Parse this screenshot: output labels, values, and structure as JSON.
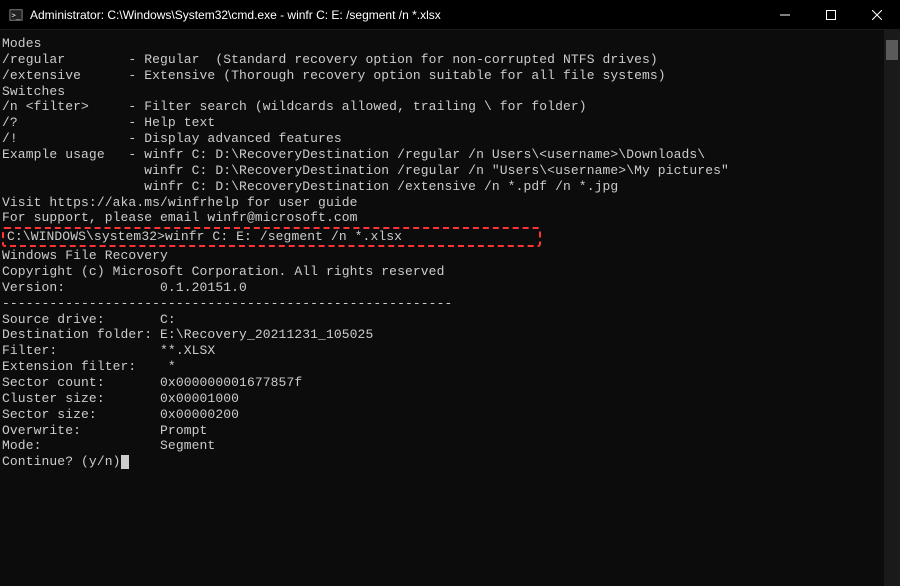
{
  "titlebar": {
    "title": "Administrator: C:\\Windows\\System32\\cmd.exe - winfr  C: E: /segment /n *.xlsx"
  },
  "terminal": {
    "lines": [
      "Modes",
      "/regular        - Regular  (Standard recovery option for non-corrupted NTFS drives)",
      "/extensive      - Extensive (Thorough recovery option suitable for all file systems)",
      "",
      "Switches",
      "/n <filter>     - Filter search (wildcards allowed, trailing \\ for folder)",
      "/?              - Help text",
      "/!              - Display advanced features",
      "",
      "Example usage   - winfr C: D:\\RecoveryDestination /regular /n Users\\<username>\\Downloads\\",
      "                  winfr C: D:\\RecoveryDestination /regular /n \"Users\\<username>\\My pictures\"",
      "                  winfr C: D:\\RecoveryDestination /extensive /n *.pdf /n *.jpg",
      "",
      "",
      "Visit https://aka.ms/winfrhelp for user guide",
      "For support, please email winfr@microsoft.com",
      ""
    ],
    "highlighted_command": "C:\\WINDOWS\\system32>winfr C: E: /segment /n *.xlsx",
    "lines_after": [
      "",
      "Windows File Recovery",
      "Copyright (c) Microsoft Corporation. All rights reserved",
      "Version:            0.1.20151.0",
      "---------------------------------------------------------",
      "",
      "Source drive:       C:",
      "Destination folder: E:\\Recovery_20211231_105025",
      "Filter:             **.XLSX",
      "Extension filter:    *",
      "",
      "Sector count:       0x000000001677857f",
      "Cluster size:       0x00001000",
      "Sector size:        0x00000200",
      "Overwrite:          Prompt",
      "Mode:               Segment",
      "",
      ""
    ],
    "prompt": "Continue? (y/n)"
  }
}
